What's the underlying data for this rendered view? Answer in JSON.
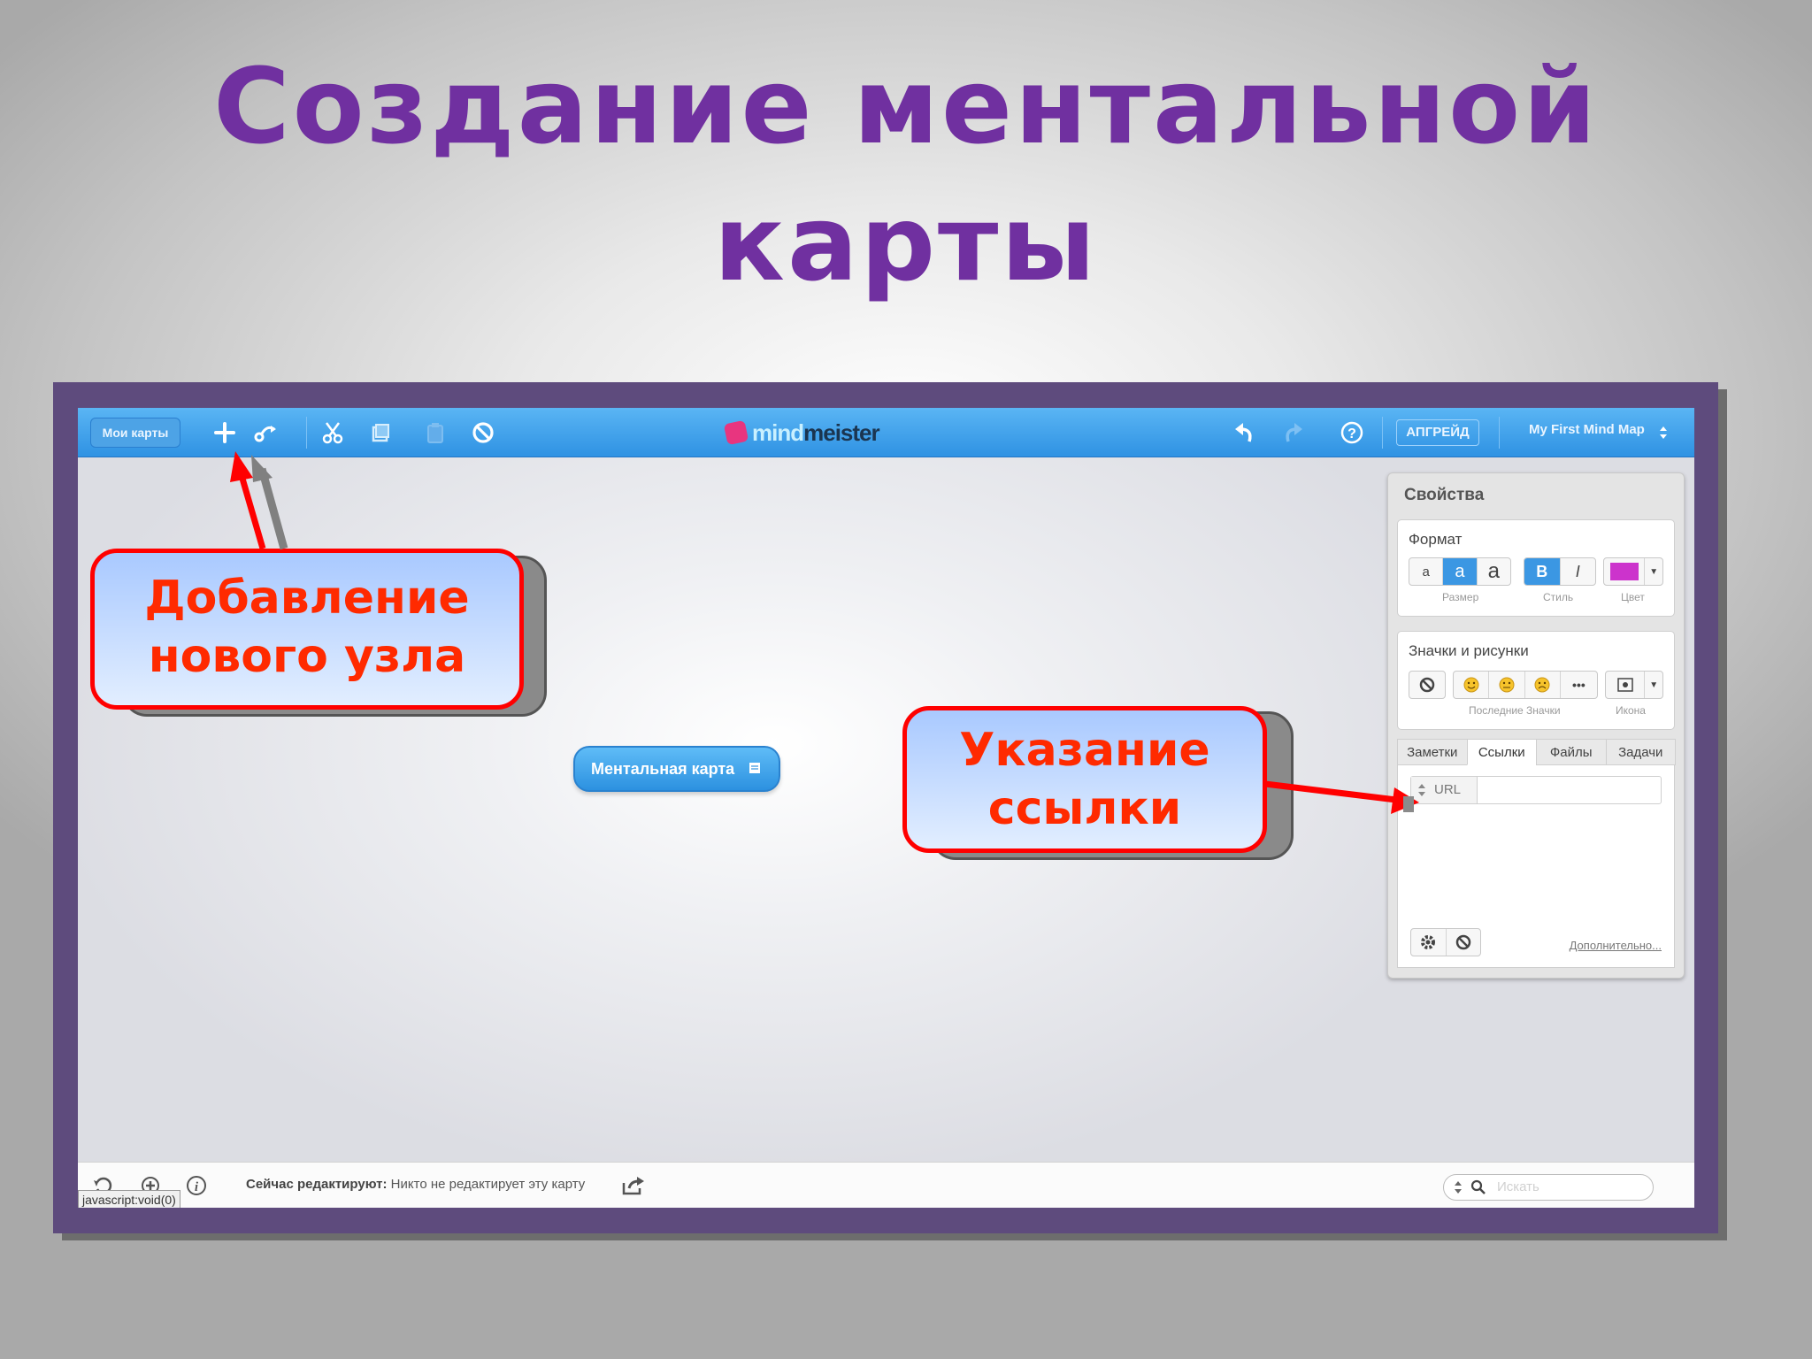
{
  "slide": {
    "title_line1": "Создание ментальной",
    "title_line2": "карты"
  },
  "toolbar": {
    "back_label": "Мои карты",
    "logo_part1": "mind",
    "logo_part2": "meister",
    "upgrade_label": "АПГРЕЙД",
    "map_name": "My First Mind Map",
    "icons": [
      "plus-icon",
      "connect-icon",
      "cut-icon",
      "copy-icon",
      "paste-icon",
      "delete-icon",
      "undo-icon",
      "redo-icon",
      "help-icon",
      "chevron-updown-icon"
    ]
  },
  "properties": {
    "title": "Свойства",
    "format": {
      "title": "Формат",
      "size_letters": [
        "a",
        "a",
        "a"
      ],
      "style_bold": "B",
      "style_italic": "I",
      "caption_size": "Размер",
      "caption_style": "Стиль",
      "caption_color": "Цвет",
      "color": "#cc33cc"
    },
    "icons": {
      "title": "Значки и рисунки",
      "caption_recent": "Последние Значки",
      "caption_icon": "Икона",
      "more": "•••"
    },
    "tabs": [
      "Заметки",
      "Ссылки",
      "Файлы",
      "Задачи"
    ],
    "active_tab": "Ссылки",
    "url_label": "URL",
    "more_link": "Дополнительно..."
  },
  "map": {
    "node_label": "Ментальная карта"
  },
  "statusbar": {
    "editing_label": "Сейчас редактируют:",
    "editing_value": "Никто не редактирует эту карту",
    "search_placeholder": "Искать",
    "tooltip": "javascript:void(0)"
  },
  "callouts": {
    "add_node_line1": "Добавление",
    "add_node_line2": "нового узла",
    "link_line1": "Указание",
    "link_line2": "ссылки"
  },
  "colors": {
    "title": "#7030a0",
    "frame": "#5e4b7d",
    "toolbar": "#2f92e3",
    "callout_border": "#ff0000",
    "callout_text": "#ff2a00"
  }
}
